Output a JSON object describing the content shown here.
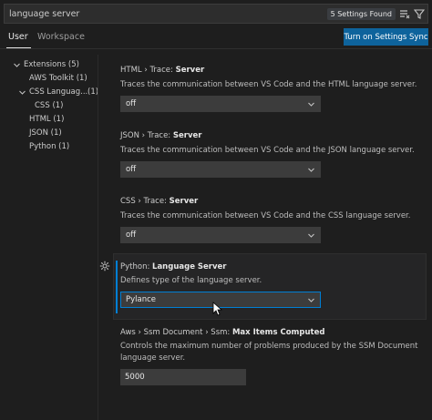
{
  "search": {
    "value": "language server",
    "found_label": "5 Settings Found"
  },
  "tabs": [
    {
      "label": "User"
    },
    {
      "label": "Workspace"
    }
  ],
  "sync_button_label": "Turn on Settings Sync",
  "toc": [
    {
      "label": "Extensions",
      "count": "(5)"
    },
    {
      "label": "AWS Toolkit",
      "count": "(1)"
    },
    {
      "label": "CSS Languag...",
      "count": "(1)"
    },
    {
      "label": "CSS",
      "count": "(1)"
    },
    {
      "label": "HTML",
      "count": "(1)"
    },
    {
      "label": "JSON",
      "count": "(1)"
    },
    {
      "label": "Python",
      "count": "(1)"
    }
  ],
  "settings": [
    {
      "category": "HTML › Trace: ",
      "name": "Server",
      "description": "Traces the communication between VS Code and the HTML language server.",
      "value": "off"
    },
    {
      "category": "JSON › Trace: ",
      "name": "Server",
      "description": "Traces the communication between VS Code and the JSON language server.",
      "value": "off"
    },
    {
      "category": "CSS › Trace: ",
      "name": "Server",
      "description": "Traces the communication between VS Code and the CSS language server.",
      "value": "off"
    },
    {
      "category": "Python: ",
      "name": "Language Server",
      "description": "Defines type of the language server.",
      "value": "Pylance"
    },
    {
      "category": "Aws › Ssm Document › Ssm: ",
      "name": "Max Items Computed",
      "description": "Controls the maximum number of problems produced by the SSM Document language server.",
      "value": "5000"
    }
  ],
  "icons": {
    "filter": "filter-icon",
    "clear": "clear-filter-icon",
    "gear": "gear-icon",
    "chevron": "chevron-down-icon"
  },
  "colors": {
    "accent": "#007fd4",
    "button": "#0e639c",
    "background": "#1e1e1e"
  }
}
